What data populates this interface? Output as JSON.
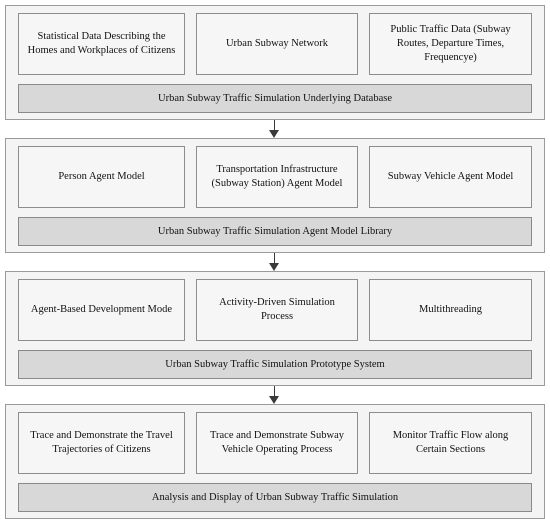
{
  "diagram": {
    "type": "flowchart",
    "orientation": "vertical-top-down",
    "tiers": [
      {
        "id": "data-layer",
        "cells": [
          "Statistical Data Describing the Homes and Workplaces of Citizens",
          "Urban Subway Network",
          "Public Traffic Data (Subway Routes, Departure Times, Frequencye)"
        ],
        "summary": "Urban Subway Traffic Simulation Underlying Database"
      },
      {
        "id": "agent-model-layer",
        "cells": [
          "Person Agent Model",
          "Transportation Infrastructure (Subway Station) Agent Model",
          "Subway Vehicle Agent Model"
        ],
        "summary": "Urban Subway Traffic Simulation Agent Model Library"
      },
      {
        "id": "prototype-system-layer",
        "cells": [
          "Agent-Based Development Mode",
          "Activity-Driven Simulation Process",
          "Multithreading"
        ],
        "summary": "Urban Subway Traffic Simulation Prototype System"
      },
      {
        "id": "analysis-display-layer",
        "cells": [
          "Trace and Demonstrate the Travel Trajectories of Citizens",
          "Trace and Demonstrate Subway Vehicle Operating Process",
          "Monitor Traffic Flow along Certain Sections"
        ],
        "summary": "Analysis and Display of Urban Subway Traffic Simulation"
      }
    ],
    "connectors": [
      {
        "from": "data-layer",
        "to": "agent-model-layer",
        "marker": "arrow-down"
      },
      {
        "from": "agent-model-layer",
        "to": "prototype-system-layer",
        "marker": "arrow-down"
      },
      {
        "from": "prototype-system-layer",
        "to": "analysis-display-layer",
        "marker": "arrow-down"
      }
    ],
    "colors": {
      "page_background": "#ffffff",
      "tier_background": "#f4f4f4",
      "tier_border": "#9a9a9a",
      "cell_background": "#f6f6f6",
      "cell_border": "#8d8d8d",
      "summary_background": "#d8d8d8",
      "summary_border": "#8a8a8a",
      "arrow": "#3a3a3a",
      "text": "#111111"
    }
  }
}
